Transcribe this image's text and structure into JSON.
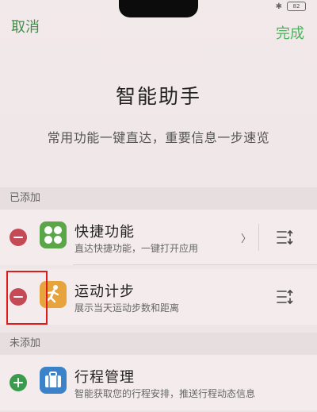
{
  "status_bar": {
    "battery": "82"
  },
  "nav": {
    "cancel_label": "取消",
    "done_label": "完成"
  },
  "header": {
    "title": "智能助手",
    "subtitle": "常用功能一键直达，重要信息一步速览"
  },
  "sections": {
    "added_label": "已添加",
    "not_added_label": "未添加"
  },
  "added_items": [
    {
      "title": "快捷功能",
      "desc": "直达快捷功能，一键打开应用",
      "icon": "four-dots-icon"
    },
    {
      "title": "运动计步",
      "desc": "展示当天运动步数和距离",
      "icon": "running-person-icon"
    }
  ],
  "not_added_items": [
    {
      "title": "行程管理",
      "desc": "智能获取您的行程安排，推送行程动态信息",
      "icon": "briefcase-icon"
    }
  ],
  "colors": {
    "accent_green": "#4fb15f",
    "remove_red": "#c44a55",
    "add_green": "#3a9b4c",
    "highlight_red": "#e11a1a"
  }
}
